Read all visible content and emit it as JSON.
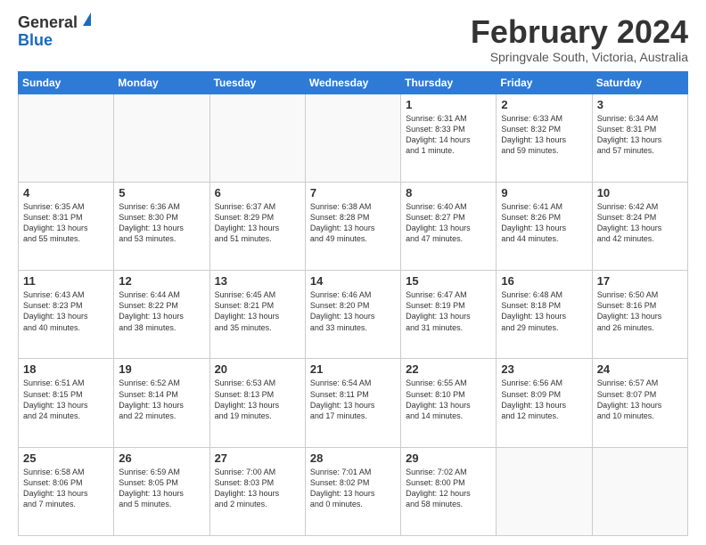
{
  "logo": {
    "general": "General",
    "blue": "Blue"
  },
  "title": "February 2024",
  "subtitle": "Springvale South, Victoria, Australia",
  "days_of_week": [
    "Sunday",
    "Monday",
    "Tuesday",
    "Wednesday",
    "Thursday",
    "Friday",
    "Saturday"
  ],
  "weeks": [
    [
      {
        "day": "",
        "info": ""
      },
      {
        "day": "",
        "info": ""
      },
      {
        "day": "",
        "info": ""
      },
      {
        "day": "",
        "info": ""
      },
      {
        "day": "1",
        "info": "Sunrise: 6:31 AM\nSunset: 8:33 PM\nDaylight: 14 hours\nand 1 minute."
      },
      {
        "day": "2",
        "info": "Sunrise: 6:33 AM\nSunset: 8:32 PM\nDaylight: 13 hours\nand 59 minutes."
      },
      {
        "day": "3",
        "info": "Sunrise: 6:34 AM\nSunset: 8:31 PM\nDaylight: 13 hours\nand 57 minutes."
      }
    ],
    [
      {
        "day": "4",
        "info": "Sunrise: 6:35 AM\nSunset: 8:31 PM\nDaylight: 13 hours\nand 55 minutes."
      },
      {
        "day": "5",
        "info": "Sunrise: 6:36 AM\nSunset: 8:30 PM\nDaylight: 13 hours\nand 53 minutes."
      },
      {
        "day": "6",
        "info": "Sunrise: 6:37 AM\nSunset: 8:29 PM\nDaylight: 13 hours\nand 51 minutes."
      },
      {
        "day": "7",
        "info": "Sunrise: 6:38 AM\nSunset: 8:28 PM\nDaylight: 13 hours\nand 49 minutes."
      },
      {
        "day": "8",
        "info": "Sunrise: 6:40 AM\nSunset: 8:27 PM\nDaylight: 13 hours\nand 47 minutes."
      },
      {
        "day": "9",
        "info": "Sunrise: 6:41 AM\nSunset: 8:26 PM\nDaylight: 13 hours\nand 44 minutes."
      },
      {
        "day": "10",
        "info": "Sunrise: 6:42 AM\nSunset: 8:24 PM\nDaylight: 13 hours\nand 42 minutes."
      }
    ],
    [
      {
        "day": "11",
        "info": "Sunrise: 6:43 AM\nSunset: 8:23 PM\nDaylight: 13 hours\nand 40 minutes."
      },
      {
        "day": "12",
        "info": "Sunrise: 6:44 AM\nSunset: 8:22 PM\nDaylight: 13 hours\nand 38 minutes."
      },
      {
        "day": "13",
        "info": "Sunrise: 6:45 AM\nSunset: 8:21 PM\nDaylight: 13 hours\nand 35 minutes."
      },
      {
        "day": "14",
        "info": "Sunrise: 6:46 AM\nSunset: 8:20 PM\nDaylight: 13 hours\nand 33 minutes."
      },
      {
        "day": "15",
        "info": "Sunrise: 6:47 AM\nSunset: 8:19 PM\nDaylight: 13 hours\nand 31 minutes."
      },
      {
        "day": "16",
        "info": "Sunrise: 6:48 AM\nSunset: 8:18 PM\nDaylight: 13 hours\nand 29 minutes."
      },
      {
        "day": "17",
        "info": "Sunrise: 6:50 AM\nSunset: 8:16 PM\nDaylight: 13 hours\nand 26 minutes."
      }
    ],
    [
      {
        "day": "18",
        "info": "Sunrise: 6:51 AM\nSunset: 8:15 PM\nDaylight: 13 hours\nand 24 minutes."
      },
      {
        "day": "19",
        "info": "Sunrise: 6:52 AM\nSunset: 8:14 PM\nDaylight: 13 hours\nand 22 minutes."
      },
      {
        "day": "20",
        "info": "Sunrise: 6:53 AM\nSunset: 8:13 PM\nDaylight: 13 hours\nand 19 minutes."
      },
      {
        "day": "21",
        "info": "Sunrise: 6:54 AM\nSunset: 8:11 PM\nDaylight: 13 hours\nand 17 minutes."
      },
      {
        "day": "22",
        "info": "Sunrise: 6:55 AM\nSunset: 8:10 PM\nDaylight: 13 hours\nand 14 minutes."
      },
      {
        "day": "23",
        "info": "Sunrise: 6:56 AM\nSunset: 8:09 PM\nDaylight: 13 hours\nand 12 minutes."
      },
      {
        "day": "24",
        "info": "Sunrise: 6:57 AM\nSunset: 8:07 PM\nDaylight: 13 hours\nand 10 minutes."
      }
    ],
    [
      {
        "day": "25",
        "info": "Sunrise: 6:58 AM\nSunset: 8:06 PM\nDaylight: 13 hours\nand 7 minutes."
      },
      {
        "day": "26",
        "info": "Sunrise: 6:59 AM\nSunset: 8:05 PM\nDaylight: 13 hours\nand 5 minutes."
      },
      {
        "day": "27",
        "info": "Sunrise: 7:00 AM\nSunset: 8:03 PM\nDaylight: 13 hours\nand 2 minutes."
      },
      {
        "day": "28",
        "info": "Sunrise: 7:01 AM\nSunset: 8:02 PM\nDaylight: 13 hours\nand 0 minutes."
      },
      {
        "day": "29",
        "info": "Sunrise: 7:02 AM\nSunset: 8:00 PM\nDaylight: 12 hours\nand 58 minutes."
      },
      {
        "day": "",
        "info": ""
      },
      {
        "day": "",
        "info": ""
      }
    ]
  ]
}
